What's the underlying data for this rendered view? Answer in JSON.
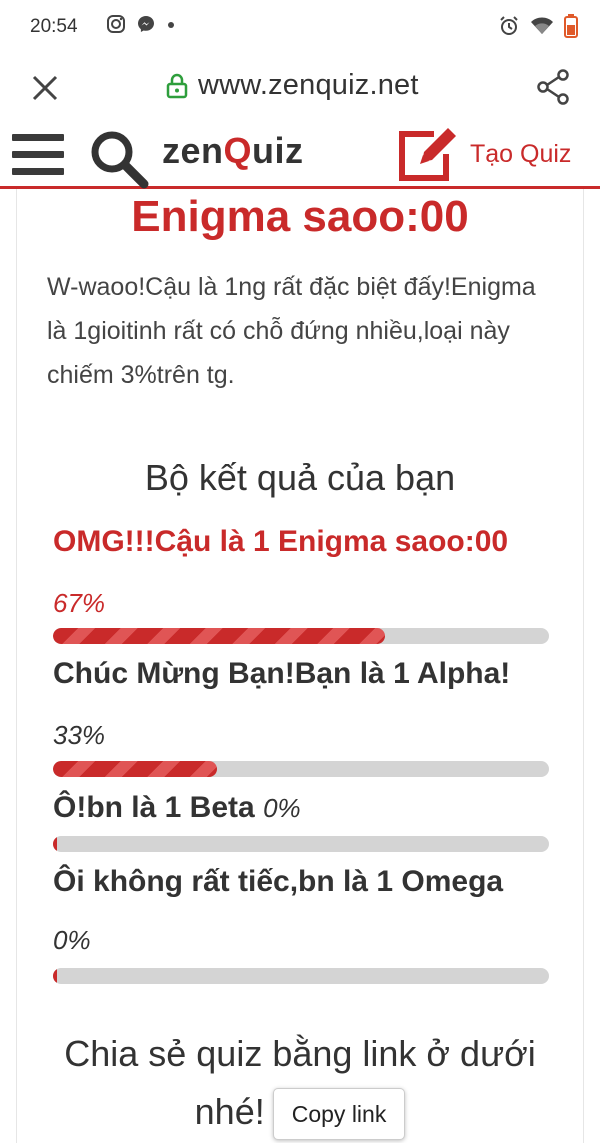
{
  "status_bar": {
    "time": "20:54",
    "left_icons": [
      "instagram-icon",
      "messenger-icon",
      "dot-icon"
    ],
    "right_icons": [
      "alarm-icon",
      "wifi-icon",
      "battery-icon"
    ]
  },
  "browser": {
    "url": "www.zenquiz.net"
  },
  "site": {
    "logo_pre": "zen",
    "logo_q": "Q",
    "logo_post": "uiz",
    "create_label": "Tạo Quiz",
    "accent_color": "#c92a2a"
  },
  "result": {
    "title": "Enigma saoo:00",
    "description": "W-waoo!Cậu là 1ng rất đặc biệt đấy!Enigma là 1gioitinh rất có chỗ đứng nhiều,loại này chiếm 3%trên tg."
  },
  "results_heading": "Bộ kết quả của bạn",
  "results": [
    {
      "label": "OMG!!!Cậu là 1 Enigma saoo:00",
      "percent_text": "67%",
      "percent": 67,
      "winner": true
    },
    {
      "label": "Chúc Mừng Bạn!Bạn là 1 Alpha!",
      "percent_text": "33%",
      "percent": 33,
      "winner": false
    },
    {
      "label": "Ô!bn là 1 Beta",
      "percent_text": "0%",
      "percent": 0,
      "winner": false
    },
    {
      "label": "Ôi không rất tiếc,bn là 1 Omega",
      "percent_text": "0%",
      "percent": 0,
      "winner": false
    }
  ],
  "share": {
    "text_line1": "Chia sẻ quiz bằng link ở dưới",
    "text_line2": "nhé!",
    "copy_label": "Copy link"
  }
}
